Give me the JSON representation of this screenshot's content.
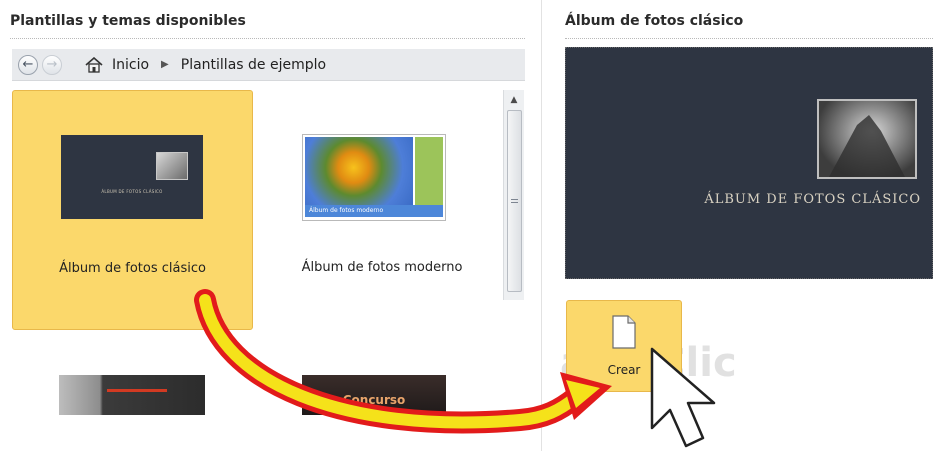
{
  "left_panel": {
    "title": "Plantillas y temas disponibles",
    "nav": {
      "back_icon": "back-arrow-icon",
      "forward_icon": "forward-arrow-icon",
      "home_icon": "home-icon",
      "crumb_home": "Inicio",
      "crumb_current": "Plantillas de ejemplo"
    },
    "templates": [
      {
        "label": "Álbum de fotos clásico",
        "thumb_caption": "ÁLBUM DE FOTOS CLÁSICO",
        "selected": true
      },
      {
        "label": "Álbum de fotos moderno",
        "thumb_caption": "Álbum de fotos moderno",
        "selected": false
      },
      {
        "label": "",
        "selected": false
      },
      {
        "label": "",
        "thumb_caption": "Concurso",
        "selected": false
      }
    ]
  },
  "right_panel": {
    "title": "Álbum de fotos clásico",
    "preview_title": "ÁLBUM DE FOTOS CLÁSICO",
    "create_button": {
      "label": "Crear",
      "icon": "new-document-icon"
    }
  },
  "overlay": {
    "watermark": "aulaClic",
    "arrow": "annotation-arrow",
    "cursor": "mouse-pointer-icon"
  },
  "colors": {
    "selection": "#fbd86b",
    "thumbnail_dark": "#2e3542",
    "arrow_red": "#e21b1b",
    "arrow_yellow": "#f5e21a"
  }
}
